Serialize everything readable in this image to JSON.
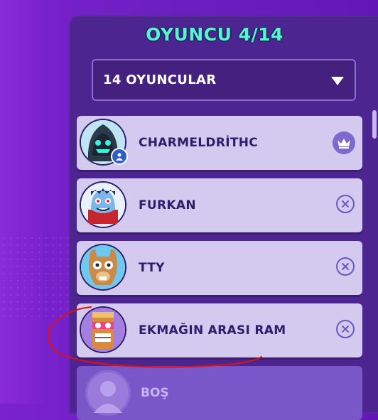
{
  "title": "OYUNCU 4/14",
  "filter": {
    "selected": "14 OYUNCULAR"
  },
  "players": [
    {
      "name": "CHARMELDRİTHC",
      "action": "crown-icon"
    },
    {
      "name": "FURKAN",
      "action": "close-icon"
    },
    {
      "name": "TTY",
      "action": "close-icon"
    },
    {
      "name": "EKMAĞIN ARASI RAM",
      "action": "close-icon"
    }
  ],
  "empty_slot": {
    "label": "BOŞ"
  },
  "colors": {
    "accent": "#5ef0d0",
    "panel": "#4d2590",
    "card": "#d4c9ee",
    "annotation": "#e01010"
  }
}
